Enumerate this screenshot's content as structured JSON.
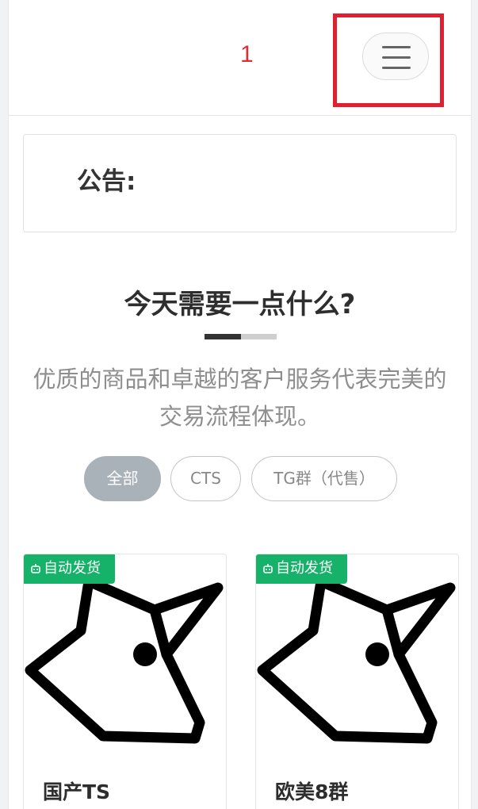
{
  "header": {
    "number": "1",
    "menu_icon": "hamburger-icon"
  },
  "notice": {
    "label": "公告:"
  },
  "section": {
    "title": "今天需要一点什么?",
    "subtitle": "优质的商品和卓越的客户服务代表完美的交易流程体现。"
  },
  "filters": [
    {
      "label": "全部",
      "active": true
    },
    {
      "label": "CTS",
      "active": false
    },
    {
      "label": "TG群（代售）",
      "active": false
    }
  ],
  "products": [
    {
      "badge": "自动发货",
      "name": "国产TS",
      "image_icon": "unicorn-icon"
    },
    {
      "badge": "自动发货",
      "name": "欧美8群",
      "image_icon": "unicorn-icon"
    }
  ],
  "colors": {
    "accent_red": "#d9303a",
    "badge_green": "#17b26a",
    "active_filter": "#a9b1b9",
    "highlight_box": "#e02030"
  }
}
